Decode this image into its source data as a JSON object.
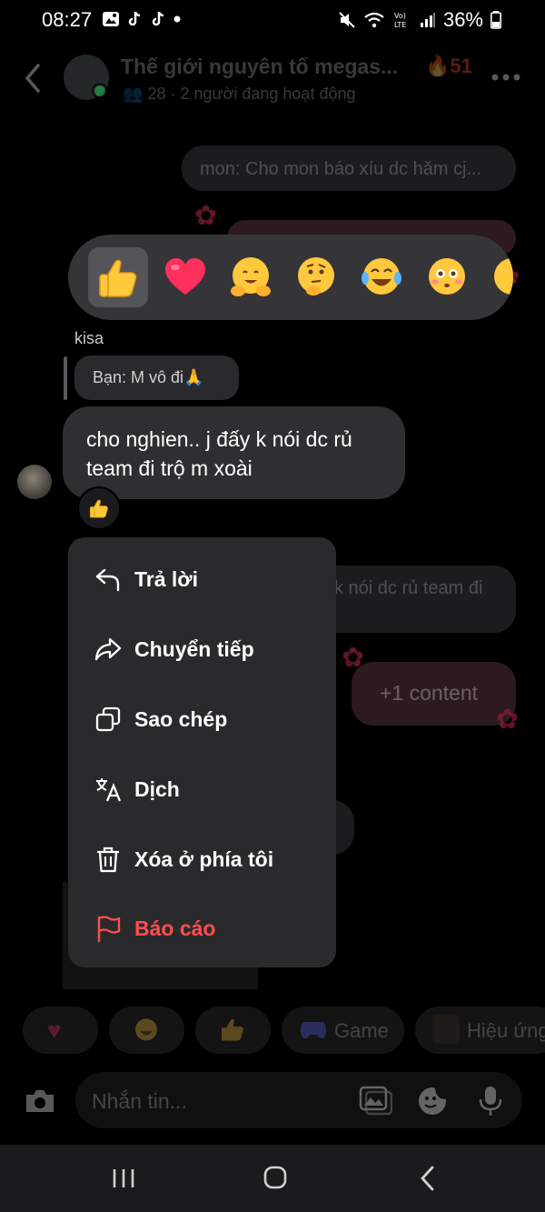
{
  "status_bar": {
    "time": "08:27",
    "battery": "36%",
    "network": "LTE"
  },
  "header": {
    "group_name": "Thế giới nguyên tố megas...",
    "streak_count": "51",
    "members_count": "28",
    "active_text": "2 người đang hoạt động"
  },
  "background_messages": {
    "top_message": "mon: Cho mon báo xíu dc hăm cj...",
    "middle_message": "k nói dc rủ team đi",
    "content_message": "+1 content"
  },
  "reactions": [
    "thumbs-up",
    "heart",
    "hugging-face",
    "thinking-face",
    "tears-of-joy",
    "flushed-face",
    "partial-emoji"
  ],
  "message": {
    "sender": "kisa",
    "reply_preview": "Bạn: M vô đi🙏",
    "text": "cho nghien.. j đấy k nói dc rủ team đi trộ m xoài",
    "reaction": "thumbs-up"
  },
  "context_menu": {
    "items": [
      {
        "label": "Trả lời",
        "icon": "reply-icon"
      },
      {
        "label": "Chuyển tiếp",
        "icon": "forward-icon"
      },
      {
        "label": "Sao chép",
        "icon": "copy-icon"
      },
      {
        "label": "Dịch",
        "icon": "translate-icon"
      },
      {
        "label": "Xóa ở phía tôi",
        "icon": "trash-icon"
      },
      {
        "label": "Báo cáo",
        "icon": "flag-icon"
      }
    ],
    "danger_color": "#ff4d4f"
  },
  "quick_actions": {
    "game_label": "Game",
    "effects_label": "Hiệu ứng"
  },
  "composer": {
    "placeholder": "Nhắn tin..."
  }
}
